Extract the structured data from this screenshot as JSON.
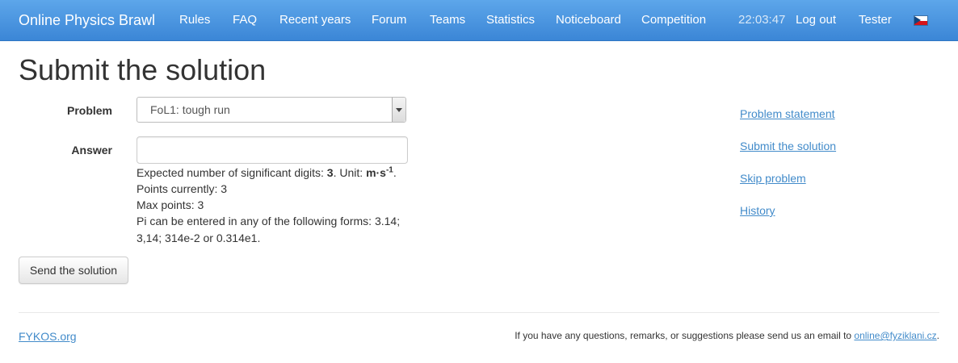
{
  "navbar": {
    "brand": "Online Physics Brawl",
    "items": [
      "Rules",
      "FAQ",
      "Recent years",
      "Forum",
      "Teams",
      "Statistics",
      "Noticeboard",
      "Competition"
    ],
    "clock": "22:03:47",
    "logout": "Log out",
    "user": "Tester",
    "language_flag": "czech-flag-icon"
  },
  "page": {
    "title": "Submit the solution"
  },
  "form": {
    "problem_label": "Problem",
    "problem_selected": "FoL1: tough run",
    "answer_label": "Answer",
    "answer_value": "",
    "help": {
      "digits_prefix": "Expected number of significant digits: ",
      "digits_value": "3",
      "unit_prefix": ". Unit: ",
      "unit_base": "m·s",
      "unit_exponent": "-1",
      "unit_suffix": ".",
      "points_current": "Points currently: 3",
      "points_max": "Max points: 3",
      "pi_line1": "Pi can be entered in any of the following forms: 3.14;",
      "pi_line2": "3,14; 314e-2 or 0.314e1."
    },
    "submit_label": "Send the solution"
  },
  "sidebar": {
    "links": [
      "Problem statement",
      "Submit the solution",
      "Skip problem",
      "History"
    ]
  },
  "footer": {
    "left_link": "FYKOS.org",
    "contact_text": "If you have any questions, remarks, or suggestions please send us an email to ",
    "contact_email": "online@fyziklani.cz",
    "contact_suffix": "."
  },
  "colors": {
    "navbar": "#3b86d6",
    "link": "#428bca"
  }
}
